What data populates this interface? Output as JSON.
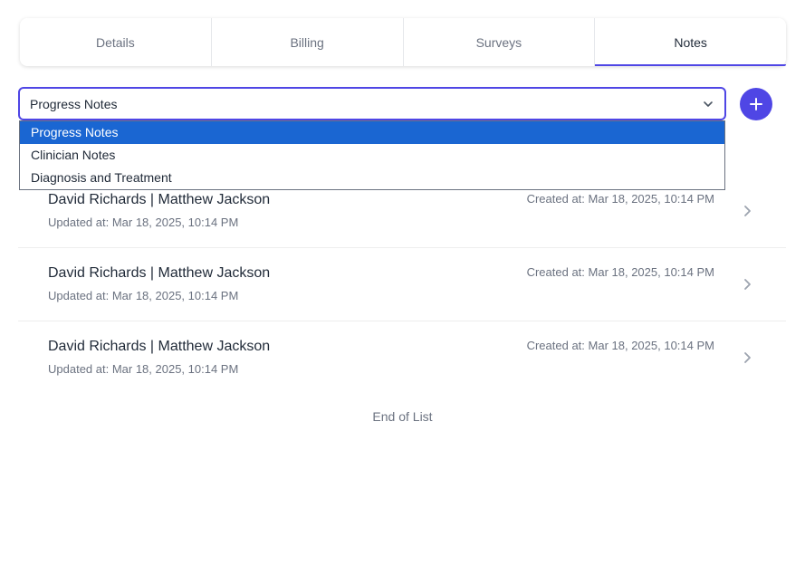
{
  "tabs": [
    {
      "label": "Details"
    },
    {
      "label": "Billing"
    },
    {
      "label": "Surveys"
    },
    {
      "label": "Notes"
    }
  ],
  "note_type_select": {
    "value": "Progress Notes",
    "options": [
      {
        "label": "Progress Notes"
      },
      {
        "label": "Clinician Notes"
      },
      {
        "label": "Diagnosis and Treatment"
      }
    ]
  },
  "notes": [
    {
      "title": "David Richards | Matthew Jackson",
      "updated": "Updated at: Mar 18, 2025, 10:14 PM",
      "created": "Created at: Mar 18, 2025, 10:14 PM"
    },
    {
      "title": "David Richards | Matthew Jackson",
      "updated": "Updated at: Mar 18, 2025, 10:14 PM",
      "created": "Created at: Mar 18, 2025, 10:14 PM"
    },
    {
      "title": "David Richards | Matthew Jackson",
      "updated": "Updated at: Mar 18, 2025, 10:14 PM",
      "created": "Created at: Mar 18, 2025, 10:14 PM"
    }
  ],
  "end_of_list": "End of List",
  "colors": {
    "accent": "#4f46e5",
    "selected_option": "#1a66d2"
  }
}
